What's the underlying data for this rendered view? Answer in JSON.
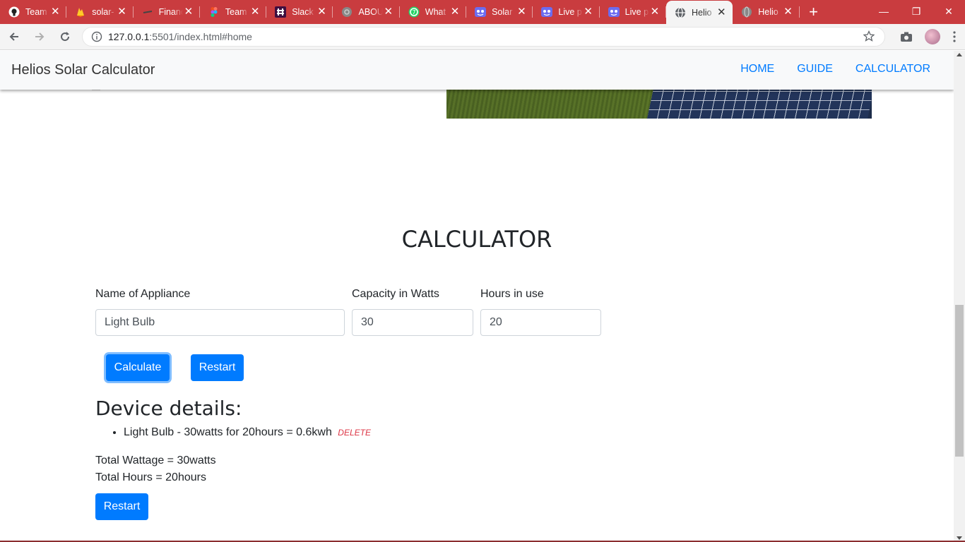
{
  "browser": {
    "tabs": [
      {
        "title": "Team",
        "icon": "github-icon"
      },
      {
        "title": "solar-",
        "icon": "firebase-icon"
      },
      {
        "title": "Financ",
        "icon": "finance-icon"
      },
      {
        "title": "Team",
        "icon": "figma-icon"
      },
      {
        "title": "Slack",
        "icon": "slack-icon"
      },
      {
        "title": "ABOU",
        "icon": "globe-icon"
      },
      {
        "title": "What",
        "icon": "whatsapp-icon"
      },
      {
        "title": "Solar",
        "icon": "mask-icon"
      },
      {
        "title": "Live p",
        "icon": "mask-icon"
      },
      {
        "title": "Live p",
        "icon": "mask-icon"
      },
      {
        "title": "Helio",
        "icon": "globe-icon",
        "active": true
      },
      {
        "title": "Helio",
        "icon": "globe-icon"
      }
    ],
    "url_host": "127.0.0.1",
    "url_rest": ":5501/index.html#home",
    "accent": "#c93c3f"
  },
  "navbar": {
    "brand": "Helios Solar Calculator",
    "links": [
      "HOME",
      "GUIDE",
      "CALCULATOR"
    ]
  },
  "calculator": {
    "title": "CALCULATOR",
    "fields": [
      {
        "label": "Name of Appliance",
        "value": "Light Bulb"
      },
      {
        "label": "Capacity in Watts",
        "value": "30"
      },
      {
        "label": "Hours in use",
        "value": "20"
      }
    ],
    "calculate_label": "Calculate",
    "restart_label": "Restart"
  },
  "device_details": {
    "title": "Device details:",
    "items": [
      {
        "text": "Light Bulb - 30watts for 20hours = 0.6kwh",
        "delete_label": "DELETE"
      }
    ],
    "total_wattage": "Total Wattage = 30watts",
    "total_hours": "Total Hours = 20hours",
    "restart_label": "Restart"
  },
  "colors": {
    "primary": "#007bff",
    "danger": "#dc3545"
  }
}
